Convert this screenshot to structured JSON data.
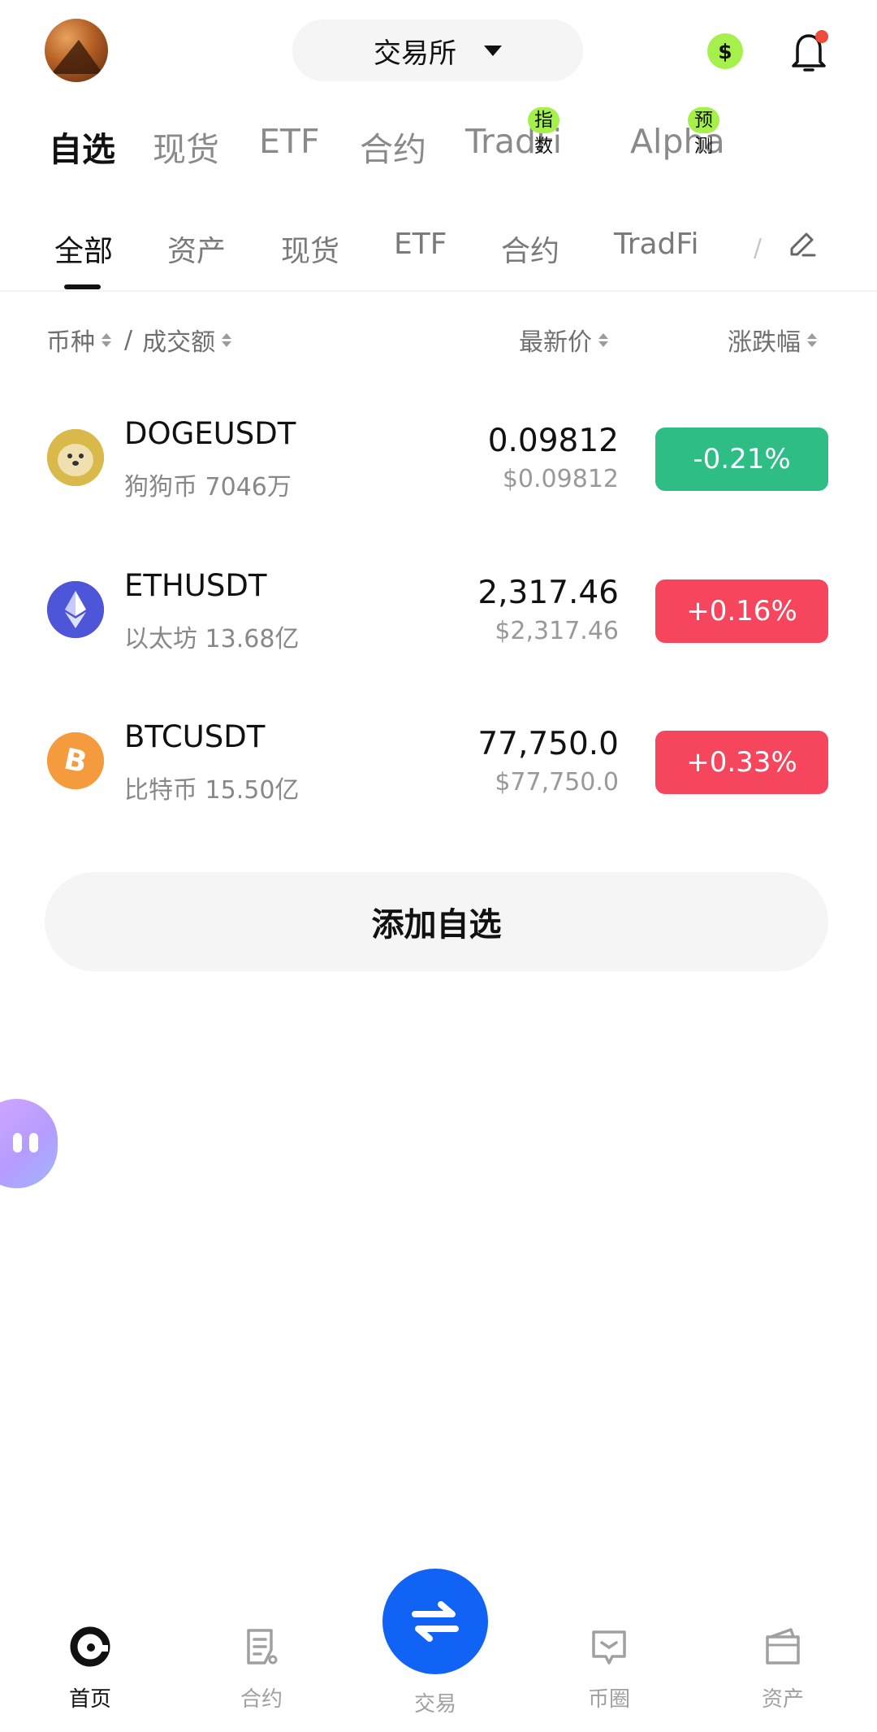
{
  "header": {
    "exchange_label": "交易所",
    "dollar_symbol": "$"
  },
  "main_tabs": [
    {
      "label": "自选",
      "active": true
    },
    {
      "label": "现货"
    },
    {
      "label": "ETF"
    },
    {
      "label": "合约"
    },
    {
      "label": "TradFi",
      "tag": "指数"
    },
    {
      "label": "Alpha",
      "tag": "预测"
    }
  ],
  "sub_tabs": [
    {
      "label": "全部",
      "active": true
    },
    {
      "label": "资产"
    },
    {
      "label": "现货"
    },
    {
      "label": "ETF"
    },
    {
      "label": "合约"
    },
    {
      "label": "TradFi"
    }
  ],
  "table_header": {
    "coin": "币种",
    "slash": "/",
    "volume": "成交额",
    "last_price": "最新价",
    "change": "涨跌幅"
  },
  "rows": [
    {
      "symbol": "DOGEUSDT",
      "name": "狗狗币",
      "volume": "7046万",
      "price": "0.09812",
      "usd_price": "$0.09812",
      "change": "-0.21%",
      "change_color": "#2ebd85",
      "icon": "doge-icon"
    },
    {
      "symbol": "ETHUSDT",
      "name": "以太坊",
      "volume": "13.68亿",
      "price": "2,317.46",
      "usd_price": "$2,317.46",
      "change": "+0.16%",
      "change_color": "#f6465d",
      "icon": "eth-icon"
    },
    {
      "symbol": "BTCUSDT",
      "name": "比特币",
      "volume": "15.50亿",
      "price": "77,750.0",
      "usd_price": "$77,750.0",
      "change": "+0.33%",
      "change_color": "#f6465d",
      "icon": "btc-icon"
    }
  ],
  "add_button": "添加自选",
  "bottom_nav": [
    {
      "label": "首页",
      "icon": "home-icon",
      "active": true
    },
    {
      "label": "合约",
      "icon": "contract-icon"
    },
    {
      "label": "交易",
      "icon": "swap-icon"
    },
    {
      "label": "币圈",
      "icon": "community-icon"
    },
    {
      "label": "资产",
      "icon": "wallet-icon"
    }
  ],
  "colors": {
    "accent_green": "#a6f04b",
    "up_red": "#f6465d",
    "down_green": "#2ebd85",
    "primary_blue": "#1063f5"
  }
}
